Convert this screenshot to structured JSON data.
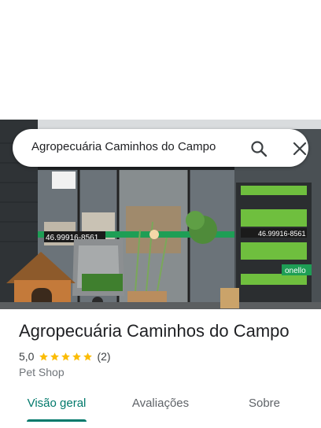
{
  "search": {
    "query": "Agropecuária Caminhos do Campo",
    "search_icon": "search-icon",
    "close_icon": "close-icon"
  },
  "hero_photo": {
    "phone_left": "46.99916-8561",
    "phone_right": "46.99916-8561",
    "shelf_label": "onello"
  },
  "place": {
    "name": "Agropecuária Caminhos do Campo",
    "rating": "5,0",
    "rating_value": 5,
    "stars_max": 5,
    "review_count": "(2)",
    "category": "Pet Shop"
  },
  "tabs": [
    {
      "label": "Visão geral",
      "active": true
    },
    {
      "label": "Avaliações",
      "active": false
    },
    {
      "label": "Sobre",
      "active": false
    }
  ],
  "colors": {
    "accent": "#00796b",
    "star": "#fbbc04",
    "text": "#202124",
    "muted": "#70757a"
  }
}
